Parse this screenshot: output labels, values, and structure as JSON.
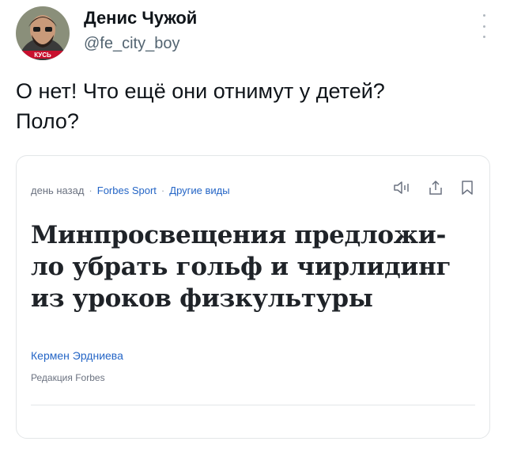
{
  "tweet": {
    "author_name": "Денис Чужой",
    "author_handle": "@fe_city_boy",
    "text_line1": "О нет! Что ещё они отнимут у детей?",
    "text_line2": "Поло?",
    "avatar_badge": "КУСЬ"
  },
  "card": {
    "time": "день назад",
    "source": "Forbes Sport",
    "other": "Другие виды",
    "headline_line1": "Минпросвещения предложи-",
    "headline_line2": "ло убрать гольф и чирлидинг",
    "headline_line3": "из уроков физкультуры",
    "author": "Кермен Эрдниева",
    "author_role": "Редакция Forbes"
  },
  "colors": {
    "link_blue": "#2465c6",
    "handle_gray": "#536471",
    "card_border": "#e3e6e8"
  },
  "icons": [
    "more-vertical-icon",
    "listen-icon",
    "share-icon",
    "bookmark-icon"
  ]
}
